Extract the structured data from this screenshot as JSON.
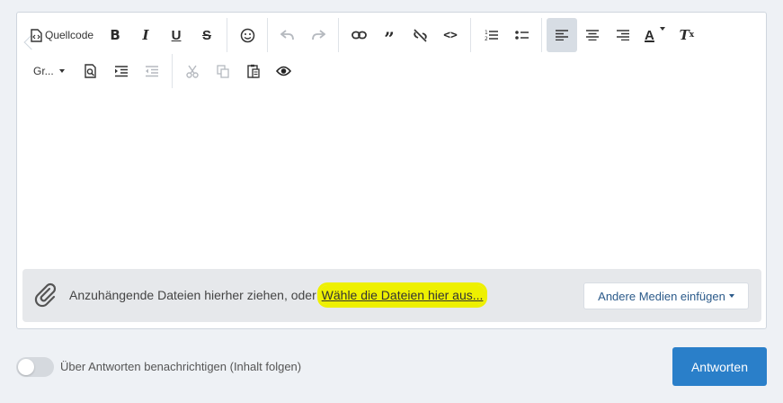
{
  "toolbar": {
    "source_label": "Quellcode",
    "bold": "B",
    "italic": "I",
    "underline": "U",
    "strike": "S",
    "quote": "”",
    "code": "<>",
    "font_color": "A",
    "clear_format": "T",
    "clear_format_sub": "x",
    "font_size_label": "Gr..."
  },
  "attachments": {
    "prompt": "Anzuhängende Dateien hierher ziehen, oder ",
    "choose_link": "Wähle die Dateien hier aus...",
    "media_button": "Andere Medien einfügen"
  },
  "footer": {
    "follow_label": "Über Antworten benachrichtigen (Inhalt folgen)",
    "reply_button": "Antworten"
  },
  "colors": {
    "accent": "#2a7fc9",
    "highlight": "#eef000"
  }
}
